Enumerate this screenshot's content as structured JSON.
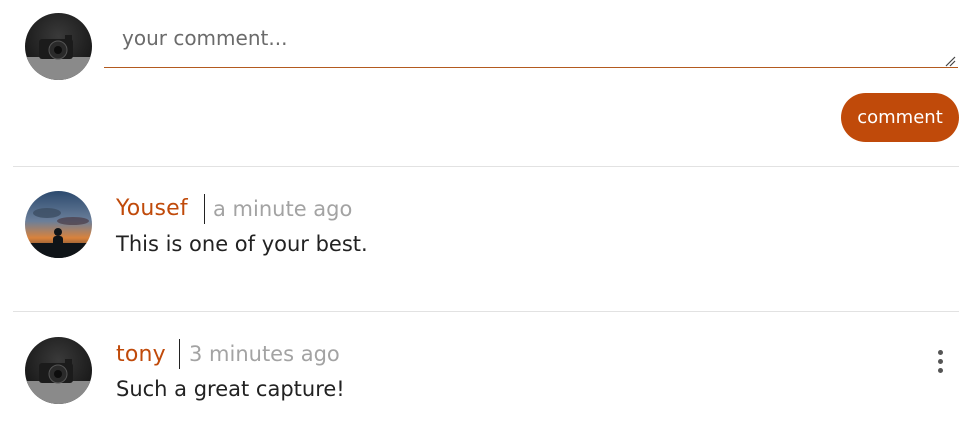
{
  "composer": {
    "placeholder": "your comment...",
    "value": "",
    "submit_label": "comment"
  },
  "comments": [
    {
      "author": "Yousef",
      "time": "a minute ago",
      "text": "This is one of your best.",
      "avatar": "sunset-silhouette-avatar"
    },
    {
      "author": "tony",
      "time": "3 minutes ago",
      "text": "Such a great capture!",
      "avatar": "camera-avatar",
      "menu_icon": "more-vertical-icon"
    }
  ],
  "colors": {
    "accent": "#c04a0a",
    "timestamp": "#a3a3a3",
    "text": "#222222",
    "divider": "#e2e2e2"
  }
}
